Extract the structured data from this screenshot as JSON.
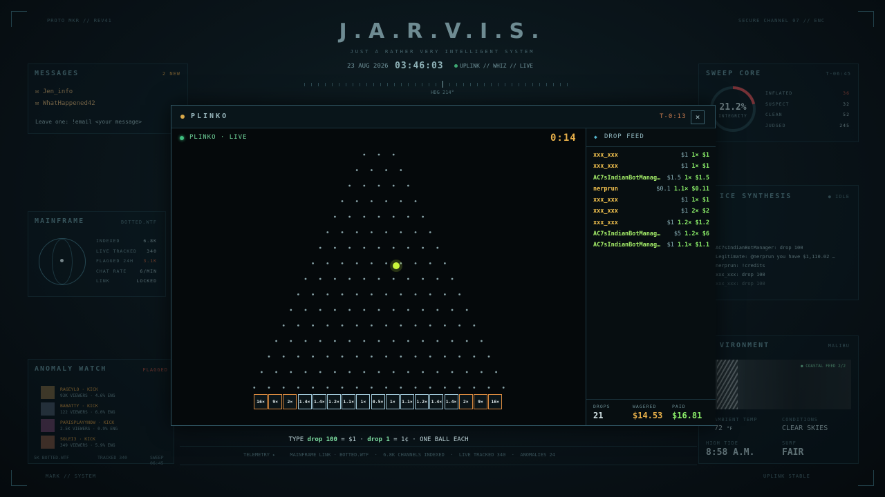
{
  "header": {
    "title": "J.A.R.V.I.S.",
    "subtitle": "JUST A RATHER VERY INTELLIGENT SYSTEM",
    "date": "23 AUG 2026",
    "clock": "03:46:03",
    "status": "UPLINK // WHIZ // LIVE",
    "heading": "HDG 214°"
  },
  "messages": {
    "title": "MESSAGES",
    "badge": "2 NEW",
    "items": [
      "Jen_info",
      "WhatHappened42"
    ],
    "hint": "Leave one: !email <your message>"
  },
  "mainframe": {
    "title": "MAINFRAME",
    "tag": "BOTTED.WTF",
    "stats": [
      {
        "k": "INDEXED",
        "v": "6.8K"
      },
      {
        "k": "LIVE TRACKED",
        "v": "340"
      },
      {
        "k": "FLAGGED 24H",
        "v": "3.1K"
      },
      {
        "k": "CHAT RATE",
        "v": "6/MIN"
      },
      {
        "k": "LINK",
        "v": "LOCKED"
      }
    ]
  },
  "anomaly": {
    "title": "ANOMALY WATCH",
    "badge": "FLAGGED",
    "items": [
      {
        "name": "RAGEYLO · KICK",
        "meta": "93K VIEWERS · 4.6% ENG"
      },
      {
        "name": "BABATTY · KICK",
        "meta": "122 VIEWERS · 6.0% ENG"
      },
      {
        "name": "PARISPLAYYNOW · KICK",
        "meta": "2.5K VIEWERS · 0.9% ENG"
      },
      {
        "name": "SOLEI3 · KICK",
        "meta": "349 VIEWERS · 5.9% ENG"
      }
    ],
    "footer": [
      "5K BOTTED.WTF",
      "TRACKED 340",
      "SWEEP 06:45"
    ]
  },
  "sweep": {
    "title": "SWEEP CORE",
    "time": "T-06:45",
    "percent": "21.2%",
    "percent_fraction": 0.212,
    "label": "INTEGRITY",
    "stats": [
      {
        "k": "INFLATED",
        "v": "36"
      },
      {
        "k": "SUSPECT",
        "v": "32"
      },
      {
        "k": "CLEAN",
        "v": "52"
      },
      {
        "k": "JUDGED",
        "v": "245"
      }
    ]
  },
  "voice": {
    "title": "ICE SYNTHESIS",
    "tag": "● IDLE",
    "log": [
      "AC7sIndianBotManager: drop 100",
      "Legitimate: @nerprun you have $1,110.02 …",
      "nerprun: !credits",
      "xxx_xxx: drop 100",
      "xxx_xxx: drop 100"
    ]
  },
  "environment": {
    "title": "VIRONMENT",
    "tag": "MALIBU",
    "feed_label": "● COASTAL FEED 2/2",
    "labels": [
      "AMBIENT TEMP",
      "CONDITIONS",
      "HIGH TIDE",
      "SURF"
    ],
    "temp": "72",
    "temp_unit": "°F",
    "conditions": "CLEAR SKIES",
    "tide": "8:58 A.M.",
    "surf": "FAIR"
  },
  "ticker": "TELEMETRY ▸     MAINFRAME LINK · BOTTED.WTF  ·  6.8K CHANNELS INDEXED  ·  LIVE TRACKED 340  ·  ANOMALIES 24",
  "corners": {
    "tl": "PROTO MKR // REV41",
    "tr": "SECURE CHANNEL 07 // ENC",
    "bl": "MARK // SYSTEM",
    "br": "UPLINK STABLE"
  },
  "plinko": {
    "window_title": "PLINKO",
    "timer": "T-0:13",
    "close_label": "×",
    "live_label": "PLINKO · LIVE",
    "countdown": "0:14",
    "multipliers": [
      "16×",
      "9×",
      "2×",
      "1.4×",
      "1.4×",
      "1.2×",
      "1.1×",
      "1×",
      "0.5×",
      "1×",
      "1.1×",
      "1.2×",
      "1.4×",
      "1.4×",
      "2×",
      "9×",
      "16×"
    ],
    "multiplier_colors": [
      "#d8893f",
      "#d8893f",
      "#d8893f",
      "#9fc6d6",
      "#9fc6d6",
      "#9fc6d6",
      "#9fc6d6",
      "#9fc6d6",
      "#9fc6d6",
      "#9fc6d6",
      "#9fc6d6",
      "#9fc6d6",
      "#9fc6d6",
      "#9fc6d6",
      "#d8893f",
      "#d8893f",
      "#d8893f"
    ],
    "instructions": {
      "p1": "TYPE ",
      "cmd1": "drop 100",
      "p2": " = $1 · ",
      "cmd2": "drop 1",
      "p3": " = 1¢ · ONE BALL EACH"
    },
    "ball_color": "#c9f53b"
  },
  "feed": {
    "title": "DROP FEED",
    "rows": [
      {
        "user": "xxx_xxx",
        "wager": "$1",
        "result": "1× $1",
        "user_color": "#f0c04e"
      },
      {
        "user": "xxx_xxx",
        "wager": "$1",
        "result": "1× $1",
        "user_color": "#f0c04e"
      },
      {
        "user": "AC7sIndianBotManager",
        "wager": "$1.5",
        "result": "1× $1.5",
        "user_color": "#a6f06a"
      },
      {
        "user": "nerprun",
        "wager": "$0.1",
        "result": "1.1× $0.11",
        "user_color": "#f0c04e"
      },
      {
        "user": "xxx_xxx",
        "wager": "$1",
        "result": "1× $1",
        "user_color": "#f0c04e"
      },
      {
        "user": "xxx_xxx",
        "wager": "$1",
        "result": "2× $2",
        "user_color": "#f0c04e"
      },
      {
        "user": "xxx_xxx",
        "wager": "$1",
        "result": "1.2× $1.2",
        "user_color": "#f0c04e"
      },
      {
        "user": "AC7sIndianBotManager",
        "wager": "$5",
        "result": "1.2× $6",
        "user_color": "#a6f06a"
      },
      {
        "user": "AC7sIndianBotManager",
        "wager": "$1",
        "result": "1.1× $1.1",
        "user_color": "#a6f06a"
      }
    ],
    "stats": {
      "drops_label": "DROPS",
      "drops": "21",
      "wagered_label": "WAGERED",
      "wagered": "$14.53",
      "paid_label": "PAID",
      "paid": "$16.81"
    }
  }
}
